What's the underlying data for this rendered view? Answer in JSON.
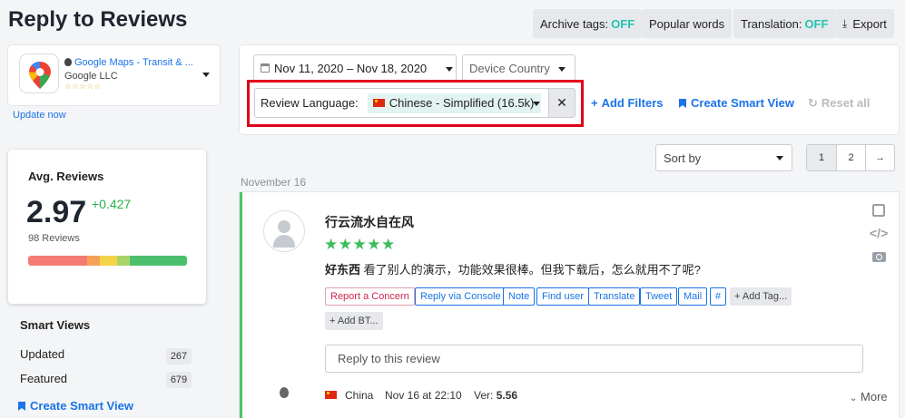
{
  "page": {
    "title": "Reply to Reviews"
  },
  "toolbar": {
    "archive_tags_label": "Archive tags:",
    "archive_tags_state": "OFF",
    "popular_words_label": "Popular words",
    "translation_label": "Translation:",
    "translation_state": "OFF",
    "export_label": "Export",
    "export_icon": "download-icon",
    "state_color": "#25c4b2"
  },
  "app": {
    "name": "Google Maps - Transit & ...",
    "developer": "Google LLC",
    "stars": "☆☆☆☆☆",
    "update_label": "Update now"
  },
  "avg_reviews": {
    "title": "Avg. Reviews",
    "value": "2.97",
    "delta": "+0.427",
    "count": "98 Reviews",
    "distribution_colors": [
      "#f47b73",
      "#f4a25a",
      "#f4d24a",
      "#a9d46a",
      "#4cbf6f"
    ]
  },
  "smart_views": {
    "title": "Smart Views",
    "items": [
      {
        "label": "Updated",
        "count": "267"
      },
      {
        "label": "Featured",
        "count": "679"
      }
    ],
    "create_label": "Create Smart View"
  },
  "filters": {
    "date_range": "Nov 11, 2020 – Nov 18, 2020",
    "country_placeholder": "Device Country",
    "language_label": "Review Language:",
    "language_value": "Chinese - Simplified (16.5k)",
    "clear_icon": "close-icon",
    "add_filters": "Add Filters",
    "create_smart_view": "Create Smart View",
    "reset_all": "Reset all"
  },
  "sort": {
    "label": "Sort by"
  },
  "pagination": {
    "pages": [
      "1",
      "2"
    ],
    "next": "→"
  },
  "date_group": "November 16",
  "review": {
    "author": "行云流水自在风",
    "stars": "★★★★★",
    "text_bold": "好东西",
    "text": " 看了别人的演示，功能效果很棒。但我下载后，怎么就用不了呢?",
    "actions": [
      "Report a Concern",
      "Reply via Console",
      "Note",
      "Find user",
      "Translate",
      "Tweet",
      "Mail",
      "#"
    ],
    "add_tag": "Add Tag...",
    "add_bt": "Add BT...",
    "reply_placeholder": "Reply to this review",
    "country": "China",
    "date": "Nov 16 at 22:10",
    "version_label": "Ver:",
    "version": "5.56",
    "more_label": "More"
  }
}
